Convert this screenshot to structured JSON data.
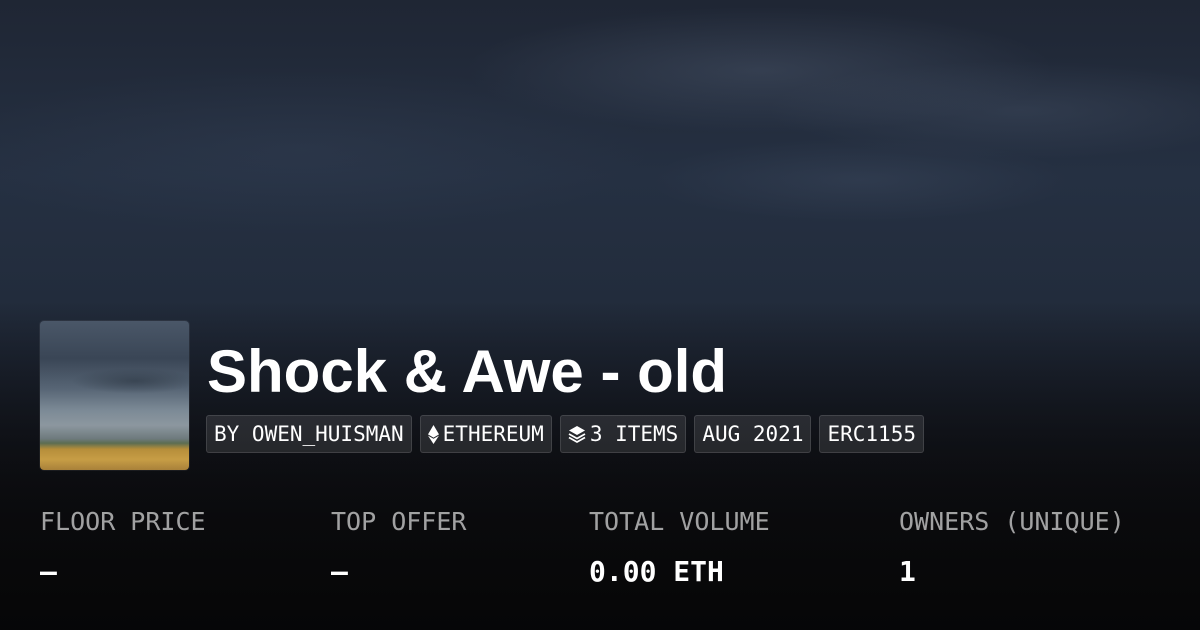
{
  "collection": {
    "title": "Shock & Awe - old",
    "thumbnail_icon": "storm-landscape-image"
  },
  "tags": [
    {
      "text": "BY OWEN_HUISMAN",
      "icon": null
    },
    {
      "text": "ETHEREUM",
      "icon": "ethereum-icon"
    },
    {
      "text": "3 ITEMS",
      "icon": "layers-icon"
    },
    {
      "text": "AUG 2021",
      "icon": null
    },
    {
      "text": "ERC1155",
      "icon": null
    }
  ],
  "stats": [
    {
      "label": "FLOOR PRICE",
      "value": "–"
    },
    {
      "label": "TOP OFFER",
      "value": "–"
    },
    {
      "label": "TOTAL VOLUME",
      "value": "0.00 ETH"
    },
    {
      "label": "OWNERS (UNIQUE)",
      "value": "1"
    }
  ],
  "colors": {
    "text": "#ffffff",
    "label": "#9e9e9e",
    "tag_background": "rgba(255,255,255,0.10)"
  }
}
